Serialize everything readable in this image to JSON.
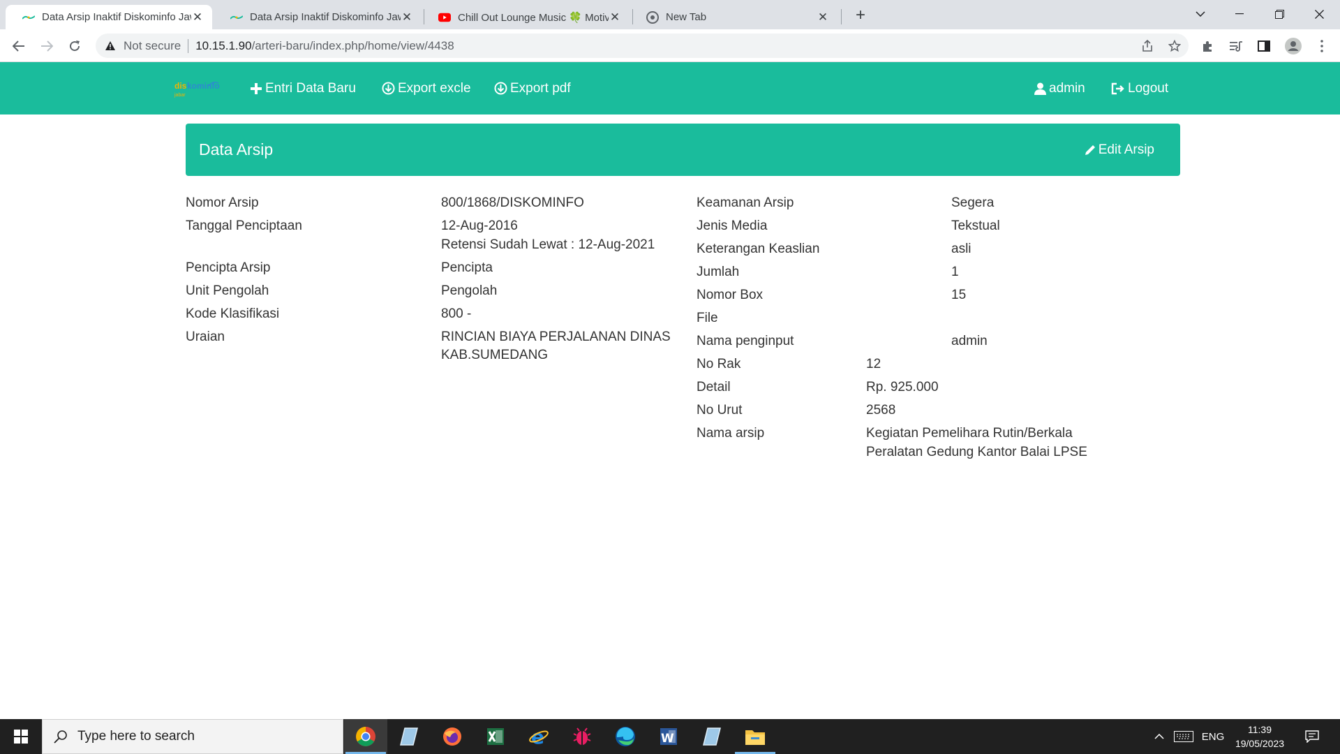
{
  "browser": {
    "tabs": [
      {
        "title": "Data Arsip Inaktif Diskominfo Jaw",
        "active": true
      },
      {
        "title": "Data Arsip Inaktif Diskominfo Jaw",
        "active": false
      },
      {
        "title": "Chill Out Lounge Music 🍀 Motiv",
        "active": false
      },
      {
        "title": "New Tab",
        "active": false
      }
    ],
    "security_label": "Not secure",
    "url_host": "10.15.1.90",
    "url_path": "/arteri-baru/index.php/home/view/4438"
  },
  "navbar": {
    "brand_text": "diskominfo",
    "brand_sub": "jabar",
    "entri_label": "Entri Data Baru",
    "export_excel_label": "Export excle",
    "export_pdf_label": "Export pdf",
    "user_label": "admin",
    "logout_label": "Logout",
    "color": "#1abc9c"
  },
  "panel": {
    "title": "Data Arsip",
    "edit_label": "Edit Arsip"
  },
  "left_fields": {
    "nomor_arsip": {
      "label": "Nomor Arsip",
      "value": "800/1868/DISKOMINFO"
    },
    "tanggal_penciptaan": {
      "label": "Tanggal Penciptaan",
      "value": "12-Aug-2016",
      "note": "Retensi Sudah Lewat : 12-Aug-2021"
    },
    "pencipta_arsip": {
      "label": "Pencipta Arsip",
      "value": "Pencipta"
    },
    "unit_pengolah": {
      "label": "Unit Pengolah",
      "value": "Pengolah"
    },
    "kode_klasifikasi": {
      "label": "Kode Klasifikasi",
      "value": "800 -"
    },
    "uraian": {
      "label": "Uraian",
      "value_line1": "RINCIAN BIAYA PERJALANAN DINAS",
      "value_line2": "KAB.SUMEDANG"
    }
  },
  "right_fields": {
    "keamanan_arsip": {
      "label": "Keamanan Arsip",
      "value": "Segera"
    },
    "jenis_media": {
      "label": "Jenis Media",
      "value": "Tekstual"
    },
    "keterangan_keaslian": {
      "label": "Keterangan Keaslian",
      "value": "asli"
    },
    "jumlah": {
      "label": "Jumlah",
      "value": "1"
    },
    "nomor_box": {
      "label": "Nomor Box",
      "value": "15"
    },
    "file": {
      "label": "File",
      "value": ""
    },
    "nama_penginput": {
      "label": "Nama penginput",
      "value": "admin"
    },
    "no_rak": {
      "label": "No Rak",
      "value": "12"
    },
    "detail": {
      "label": "Detail",
      "value": "Rp. 925.000"
    },
    "no_urut": {
      "label": "No Urut",
      "value": "2568"
    },
    "nama_arsip": {
      "label": "Nama arsip",
      "value_line1": "Kegiatan Pemelihara Rutin/Berkala",
      "value_line2": "Peralatan Gedung Kantor Balai LPSE"
    }
  },
  "taskbar": {
    "search_placeholder": "Type here to search",
    "lang": "ENG",
    "time": "11:39",
    "date": "19/05/2023",
    "apps": [
      "chrome-icon",
      "notes-icon",
      "firefox-icon",
      "excel-icon",
      "internet-explorer-icon",
      "bug-icon",
      "edge-icon",
      "word-icon",
      "notes-icon",
      "file-explorer-icon"
    ]
  }
}
